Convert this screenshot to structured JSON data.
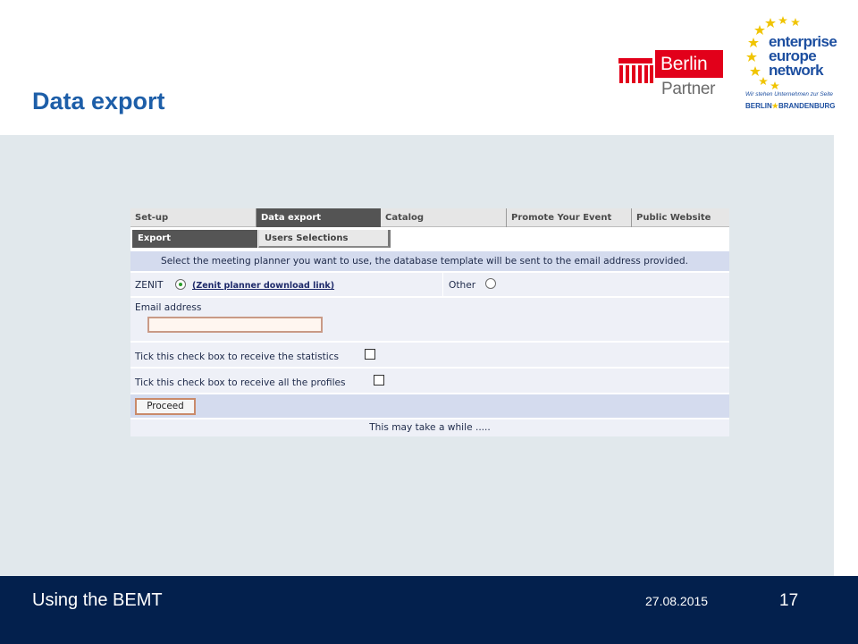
{
  "slide": {
    "title": "Data export",
    "footer": {
      "title": "Using the BEMT",
      "date": "27.08.2015",
      "page": "17"
    }
  },
  "logos": {
    "berlin_partner": {
      "top": "Berlin",
      "bottom": "Partner"
    },
    "een": {
      "line1": "enterprise",
      "line2": "europe",
      "line3": "network",
      "tagline": "Wir stehen Unternehmen zur Seite",
      "region_left": "BERLIN",
      "region_right": "BRANDENBURG"
    }
  },
  "app": {
    "tabs": [
      {
        "label": "Set-up"
      },
      {
        "label": "Data export"
      },
      {
        "label": "Catalog"
      },
      {
        "label": "Promote Your Event"
      },
      {
        "label": "Public Website"
      }
    ],
    "subtabs": [
      {
        "label": "Export"
      },
      {
        "label": "Users Selections"
      }
    ],
    "instruction": "Select the meeting planner you want to use, the database template will be sent to the email address provided.",
    "zenit_label": "ZENIT",
    "zenit_link": "(Zenit planner download link)",
    "other_label": "Other",
    "email_label": "Email address",
    "email_value": "",
    "statistics_label": "Tick this check box to receive the statistics",
    "profiles_label": "Tick this check box to receive all the profiles",
    "proceed_label": "Proceed",
    "note": "This may take a while ....."
  },
  "colors": {
    "title_blue": "#1d5ea8",
    "footer_navy": "#03204d",
    "berlin_red": "#e2001a",
    "content_gray": "#e1e8ec"
  }
}
